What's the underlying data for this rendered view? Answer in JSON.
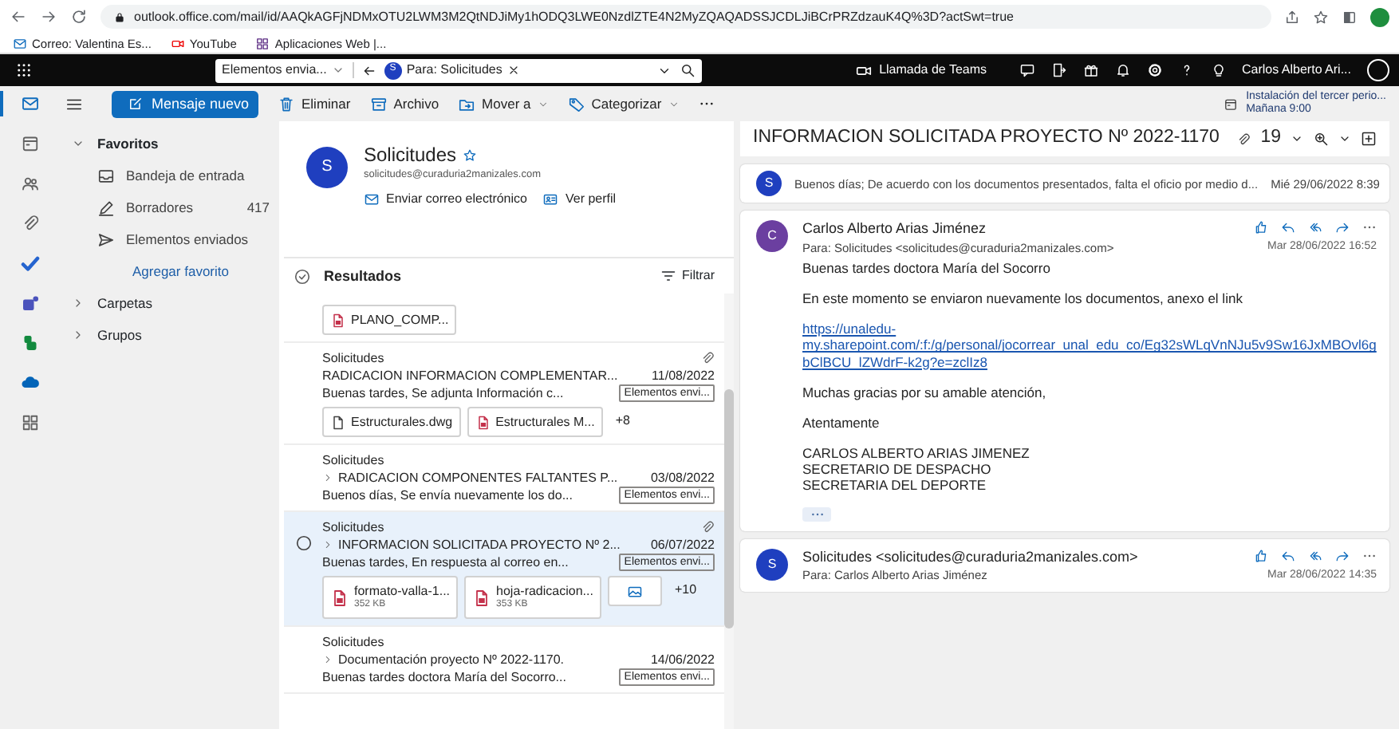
{
  "browser": {
    "url": "outlook.office.com/mail/id/AAQkAGFjNDMxOTU2LWM3M2QtNDJiMy1hODQ3LWE0NzdlZTE4N2MyZQAQADSSJCDLJiBCrPRZdzauK4Q%3D?actSwt=true",
    "bookmarks": [
      {
        "kind": "mail",
        "label": "Correo: Valentina Es..."
      },
      {
        "kind": "video",
        "label": "YouTube"
      },
      {
        "kind": "apps",
        "label": "Aplicaciones Web |..."
      }
    ]
  },
  "header": {
    "folder": "Elementos envia...",
    "search_chip": {
      "initial": "S",
      "label": "Para: Solicitudes"
    },
    "teams_call": "Llamada de Teams",
    "user": "Carlos Alberto Ari..."
  },
  "rail": [
    {
      "kind": "mail",
      "selected": true
    },
    {
      "kind": "calendar",
      "selected": false
    },
    {
      "kind": "people",
      "selected": false
    },
    {
      "kind": "attach",
      "selected": false
    },
    {
      "kind": "todo",
      "selected": false
    },
    {
      "kind": "teams",
      "selected": false
    },
    {
      "kind": "bookings",
      "selected": false
    },
    {
      "kind": "cloud",
      "selected": false
    },
    {
      "kind": "apps",
      "selected": false
    }
  ],
  "toolbar": {
    "new_message": "Mensaje nuevo",
    "actions": [
      {
        "kind": "delete",
        "label": "Eliminar",
        "menu": false
      },
      {
        "kind": "archive",
        "label": "Archivo",
        "menu": false
      },
      {
        "kind": "move",
        "label": "Mover a",
        "menu": true
      },
      {
        "kind": "tag",
        "label": "Categorizar",
        "menu": true
      }
    ]
  },
  "reminder": {
    "title": "Instalación del tercer perio...",
    "time": "Mañana 9:00"
  },
  "folders": [
    {
      "label": "Favoritos",
      "expanded": true,
      "items": [
        {
          "kind": "inbox",
          "label": "Bandeja de entrada"
        },
        {
          "kind": "drafts",
          "label": "Borradores",
          "count": "417"
        },
        {
          "kind": "sent",
          "label": "Elementos enviados"
        }
      ],
      "add": "Agregar favorito"
    },
    {
      "label": "Carpetas",
      "expanded": false
    },
    {
      "label": "Grupos",
      "expanded": false
    }
  ],
  "contact": {
    "initial": "S",
    "name": "Solicitudes",
    "email": "solicitudes@curaduria2manizales.com",
    "actions": [
      {
        "kind": "mail",
        "label": "Enviar correo electrónico"
      },
      {
        "kind": "profile",
        "label": "Ver perfil"
      }
    ]
  },
  "results": {
    "title": "Resultados",
    "filter": "Filtrar"
  },
  "messages": [
    {
      "selected": false,
      "attachments": [
        {
          "kind": "pdf",
          "name": "PLANO_COMP..."
        }
      ]
    },
    {
      "selected": false,
      "sender": "Solicitudes",
      "has_attachment": true,
      "thread": false,
      "subject": "RADICACION INFORMACION COMPLEMENTAR...",
      "date": "11/08/2022",
      "preview": "Buenas tardes, Se adjunta Información c...",
      "folder": "Elementos envi...",
      "attachments": [
        {
          "kind": "file",
          "name": "Estructurales.dwg"
        },
        {
          "kind": "pdf",
          "name": "Estructurales M..."
        }
      ],
      "more": "+8"
    },
    {
      "selected": false,
      "sender": "Solicitudes",
      "has_attachment": false,
      "thread": true,
      "subject": "RADICACION COMPONENTES FALTANTES P...",
      "date": "03/08/2022",
      "preview": "Buenos días, Se envía nuevamente los do...",
      "folder": "Elementos envi..."
    },
    {
      "selected": true,
      "sender": "Solicitudes",
      "has_attachment": true,
      "thread": true,
      "subject": "INFORMACION SOLICITADA PROYECTO Nº 2...",
      "date": "06/07/2022",
      "preview": "Buenas tardes, En respuesta al correo en...",
      "folder": "Elementos envi...",
      "attachments": [
        {
          "kind": "pdf",
          "name": "formato-valla-1...",
          "size": "352 KB"
        },
        {
          "kind": "pdf",
          "name": "hoja-radicacion...",
          "size": "353 KB"
        },
        {
          "kind": "image"
        }
      ],
      "more": "+10"
    },
    {
      "selected": false,
      "sender": "Solicitudes",
      "has_attachment": false,
      "thread": true,
      "subject": "Documentación proyecto Nº 2022-1170.",
      "date": "14/06/2022",
      "preview": "Buenas tardes doctora María del Socorro...",
      "folder": "Elementos envi..."
    }
  ],
  "reading": {
    "subject": "INFORMACION SOLICITADA PROYECTO Nº 2022-1170",
    "attachment_count": "19",
    "conversation": [
      {
        "kind": "collapsed",
        "initial": "S",
        "color": "#1f3fbf",
        "preview": "Buenos días; De acuerdo con los documentos presentados, falta el oficio por medio d...",
        "date": "Mié 29/06/2022 8:39"
      },
      {
        "kind": "expanded",
        "initial": "C",
        "color": "#6b3fa0",
        "from": "Carlos Alberto Arias Jiménez",
        "to": "Para: Solicitudes <solicitudes@curaduria2manizales.com>",
        "date": "Mar 28/06/2022 16:52",
        "body": [
          {
            "kind": "text",
            "text": "Buenas tardes doctora María del Socorro"
          },
          {
            "kind": "text",
            "text": "En este momento se enviaron nuevamente los documentos, anexo el link"
          },
          {
            "kind": "link",
            "text": "https://unaledu-my.sharepoint.com/:f:/g/personal/jocorrear_unal_edu_co/Eg32sWLqVnNJu5v9Sw16JxMBOvl6gbClBCU_lZWdrF-k2g?e=zclIz8"
          },
          {
            "kind": "text",
            "text": "Muchas gracias por su amable atención,"
          },
          {
            "kind": "text",
            "text": "Atentamente"
          },
          {
            "kind": "lines",
            "lines": [
              "CARLOS ALBERTO ARIAS JIMENEZ",
              "SECRETARIO DE DESPACHO",
              "SECRETARIA DEL DEPORTE"
            ]
          }
        ]
      },
      {
        "kind": "header",
        "initial": "S",
        "color": "#1f3fbf",
        "from": "Solicitudes <solicitudes@curaduria2manizales.com>",
        "to": "Para: Carlos Alberto Arias Jiménez",
        "date": "Mar 28/06/2022 14:35"
      }
    ]
  }
}
